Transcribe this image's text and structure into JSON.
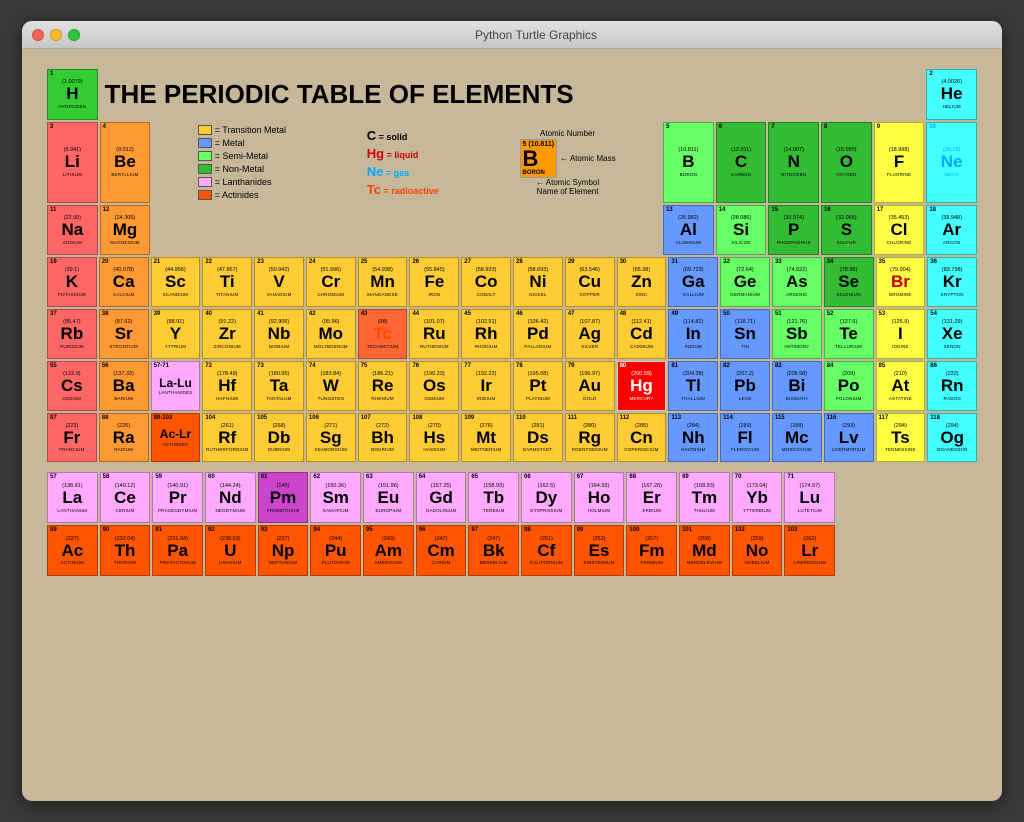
{
  "window": {
    "title": "Python Turtle Graphics"
  },
  "table": {
    "title": "THE PERIODIC TABLE OF ELEMENTS",
    "legend": [
      {
        "color": "#ffcc33",
        "label": "= Transition Metal"
      },
      {
        "color": "#6699ff",
        "label": "= Metal"
      },
      {
        "color": "#66ff66",
        "label": "= Semi-Metal"
      },
      {
        "color": "#33bb33",
        "label": "= Non-Metal"
      },
      {
        "color": "#ffaaff",
        "label": "= Lanthanides"
      },
      {
        "color": "#ff5500",
        "label": "= Actinides"
      }
    ],
    "infoLabels": {
      "atomicNumber": "Atomic Number",
      "atomicMass": "Atomic Mass",
      "atomicSymbol": "Atomic Symbol",
      "nameOfElement": "Name of Element",
      "exampleNum": "5 (10.811)",
      "exampleSym": "B",
      "exampleName": "BORON"
    },
    "stateLabels": {
      "C": "= solid",
      "Hg": "= liquid",
      "Ne": "= gas",
      "Tc": "= radioactive"
    }
  }
}
